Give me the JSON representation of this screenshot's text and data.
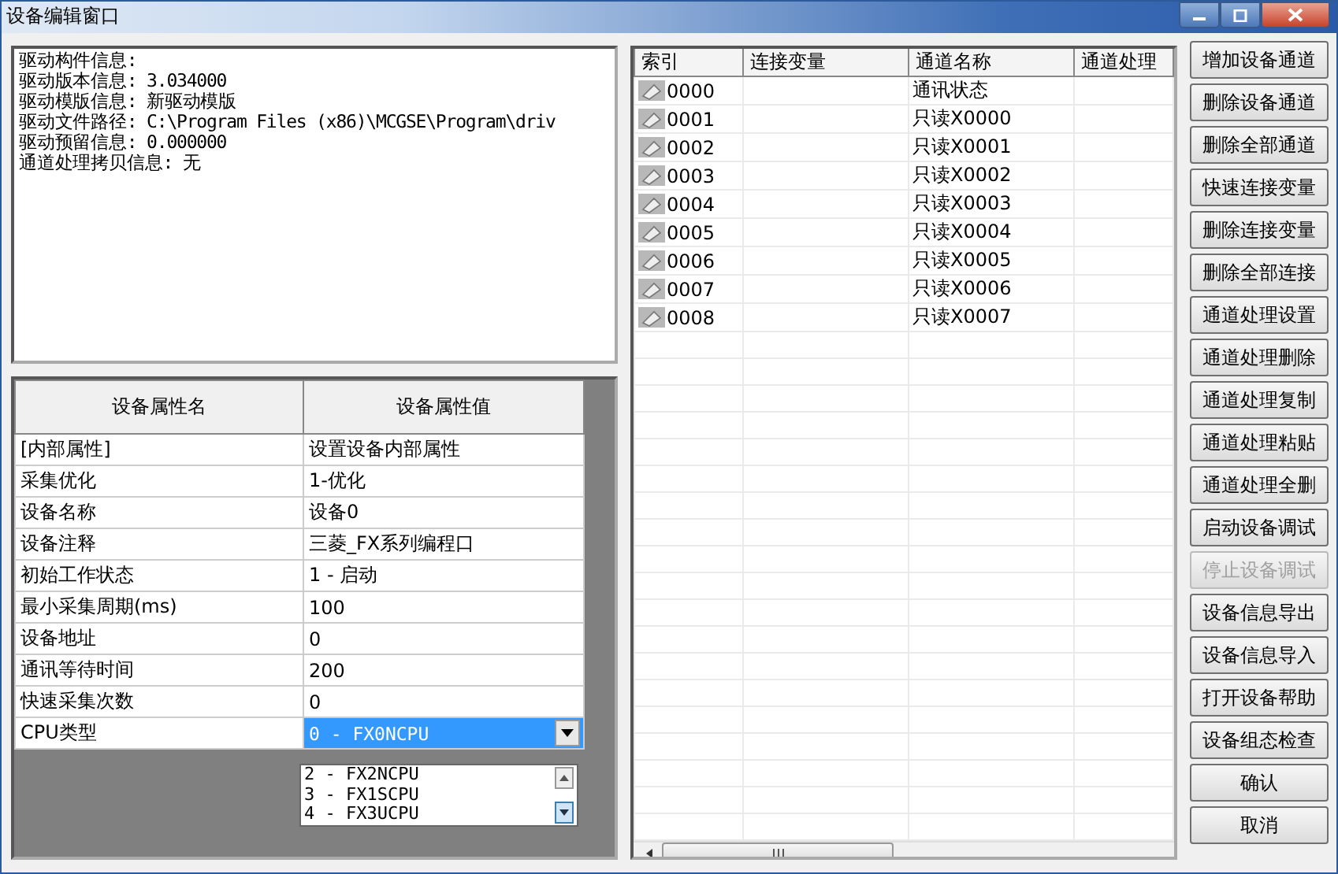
{
  "window": {
    "title": "设备编辑窗口"
  },
  "info_lines": [
    "驱动构件信息:",
    "驱动版本信息: 3.034000",
    "驱动模版信息: 新驱动模版",
    "驱动文件路径: C:\\Program Files (x86)\\MCGSE\\Program\\driv",
    "驱动预留信息: 0.000000",
    "通道处理拷贝信息: 无"
  ],
  "property_grid": {
    "columns": [
      "设备属性名",
      "设备属性值"
    ],
    "rows": [
      {
        "name": "[内部属性]",
        "value": "设置设备内部属性",
        "selected": false
      },
      {
        "name": "采集优化",
        "value": "1-优化",
        "selected": false
      },
      {
        "name": "设备名称",
        "value": "设备0",
        "selected": false
      },
      {
        "name": "设备注释",
        "value": "三菱_FX系列编程口",
        "selected": false
      },
      {
        "name": "初始工作状态",
        "value": "1 - 启动",
        "selected": false
      },
      {
        "name": "最小采集周期(ms)",
        "value": "100",
        "selected": false
      },
      {
        "name": "设备地址",
        "value": "0",
        "selected": false
      },
      {
        "name": "通讯等待时间",
        "value": "200",
        "selected": false
      },
      {
        "name": "快速采集次数",
        "value": "0",
        "selected": false
      },
      {
        "name": "CPU类型",
        "value": "0 - FX0NCPU",
        "selected": true
      }
    ],
    "dropdown_options": [
      "2 - FX2NCPU",
      "3 - FX1SCPU",
      "4 - FX3UCPU"
    ]
  },
  "channel_table": {
    "columns": [
      "索引",
      "连接变量",
      "通道名称",
      "通道处理"
    ],
    "rows": [
      {
        "index": "0000",
        "name": "通讯状态"
      },
      {
        "index": "0001",
        "name": "只读X0000"
      },
      {
        "index": "0002",
        "name": "只读X0001"
      },
      {
        "index": "0003",
        "name": "只读X0002"
      },
      {
        "index": "0004",
        "name": "只读X0003"
      },
      {
        "index": "0005",
        "name": "只读X0004"
      },
      {
        "index": "0006",
        "name": "只读X0005"
      },
      {
        "index": "0007",
        "name": "只读X0006"
      },
      {
        "index": "0008",
        "name": "只读X0007"
      }
    ]
  },
  "buttons": [
    {
      "label": "增加设备通道",
      "disabled": false
    },
    {
      "label": "删除设备通道",
      "disabled": false
    },
    {
      "label": "删除全部通道",
      "disabled": false
    },
    {
      "label": "快速连接变量",
      "disabled": false
    },
    {
      "label": "删除连接变量",
      "disabled": false
    },
    {
      "label": "删除全部连接",
      "disabled": false
    },
    {
      "label": "通道处理设置",
      "disabled": false
    },
    {
      "label": "通道处理删除",
      "disabled": false
    },
    {
      "label": "通道处理复制",
      "disabled": false
    },
    {
      "label": "通道处理粘贴",
      "disabled": false
    },
    {
      "label": "通道处理全删",
      "disabled": false
    },
    {
      "label": "启动设备调试",
      "disabled": false
    },
    {
      "label": "停止设备调试",
      "disabled": true
    },
    {
      "label": "设备信息导出",
      "disabled": false
    },
    {
      "label": "设备信息导入",
      "disabled": false
    },
    {
      "label": "打开设备帮助",
      "disabled": false
    },
    {
      "label": "设备组态检查",
      "disabled": false
    },
    {
      "label": "确认",
      "disabled": false
    },
    {
      "label": "取消",
      "disabled": false
    }
  ]
}
